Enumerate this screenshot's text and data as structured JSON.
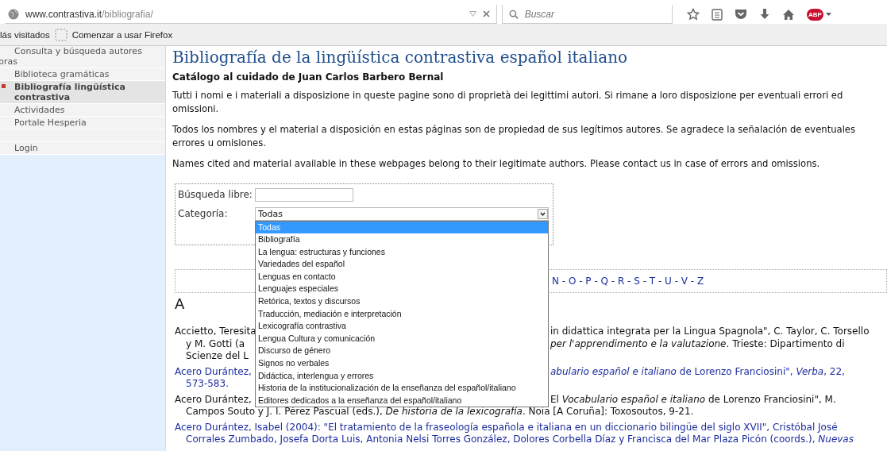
{
  "browser": {
    "url_host": "www.contrastiva.it",
    "url_path": "/bibliografia/",
    "search": {
      "placeholder": "Buscar"
    },
    "abp_label": "ABP",
    "bookmarks": [
      "lás visitados",
      "Comenzar a usar Firefox"
    ]
  },
  "sidebar": {
    "items": [
      {
        "lines": [
          "Consulta y búsqueda autores",
          "bras"
        ],
        "selected": false
      },
      {
        "lines": [
          "Biblioteca gramáticas"
        ],
        "selected": false
      },
      {
        "lines": [
          "Bibliografía lingüística",
          "contrastiva"
        ],
        "selected": true
      },
      {
        "lines": [
          "Actividades"
        ],
        "selected": false
      },
      {
        "lines": [
          "Portale Hesperia"
        ],
        "selected": false
      },
      {
        "selected": false
      },
      {
        "lines": [
          "Login"
        ],
        "selected": false
      }
    ]
  },
  "page": {
    "title": "Bibliografía de la lingüística contrastiva español italiano",
    "subtitle": "Catálogo al cuidado de Juan Carlos Barbero Bernal",
    "paragraphs": [
      "Tutti i nomi e i materiali a disposizione in queste pagine sono di proprietà dei legittimi autori. Si rimane a loro disposizione per eventuali errori ed omissioni.",
      "Todos los nombres y el material a disposición en estas páginas son de propiedad de sus legítimos autores. Se agradece la señalación de eventuales errores u omisiones.",
      "Names cited and material available in these webpages belong to their legitimate authors. Please contact us in case of errors and omissions."
    ]
  },
  "search_form": {
    "free_label": "Búsqueda libre:",
    "category_label": "Categoría:",
    "category_value": "Todas",
    "options": [
      {
        "label": "Todas",
        "selected": true
      },
      {
        "label": "Bibliografía",
        "selected": false
      },
      {
        "label": "La lengua: estructuras y funciones",
        "selected": false
      },
      {
        "label": "Variedades del español",
        "selected": false
      },
      {
        "label": "Lenguas en contacto",
        "selected": false
      },
      {
        "label": "Lenguajes especiales",
        "selected": false
      },
      {
        "label": "Retórica, textos y discursos",
        "selected": false
      },
      {
        "label": "Traducción, mediación e interpretación",
        "selected": false
      },
      {
        "label": "Lexicografía contrastiva",
        "selected": false
      },
      {
        "label": "Lengua Cultura y comunicación",
        "selected": false
      },
      {
        "label": "Discurso de género",
        "selected": false
      },
      {
        "label": "Signos no verbales",
        "selected": false
      },
      {
        "label": "Didáctica, interlengua y errores",
        "selected": false
      },
      {
        "label": "Historia de la institucionalización de la enseñanza del español/italiano",
        "selected": false
      },
      {
        "label": "Editores dedicados a la enseñanza del español/italiano",
        "selected": false
      }
    ]
  },
  "alphabet": "N - O - P - Q - R - S - T - U - V - Z",
  "section_letter": "A",
  "entries": [
    {
      "link": false,
      "lines": [
        {
          "left": "Accietto, Teresita",
          "right": "in didattica integrata per la Lingua Spagnola\", C. Taylor, C. Torsello"
        },
        {
          "left": "y M. Gotti  (a",
          "right": "*per l'apprendimento e la valutazione*. Trieste: Dipartimento di"
        },
        {
          "left": "Scienze del L"
        }
      ]
    },
    {
      "link": true,
      "lines": [
        {
          "left": "Acero Durántez,",
          "right": "*abulario español e italiano* de Lorenzo Franciosini\", *Verba*, 22,"
        },
        {
          "text": "573-583."
        }
      ]
    },
    {
      "link": false,
      "lines": [
        {
          "left": "Acero Durántez,",
          "right": "El *Vocabulario español e italiano* de Lorenzo Franciosini\", M."
        },
        {
          "text": "Campos Souto y J. I. Pérez Pascual (eds.), *De historia de la lexicografía*. Noia [A Coruña]: Toxosoutos, 9-21."
        }
      ]
    },
    {
      "link": true,
      "lines": [
        {
          "text": "Acero Durántez, Isabel (2004): \"El tratamiento de la fraseología española e italiana en un diccionario bilingüe del siglo XVII\", Cristóbal José"
        },
        {
          "text": "Corrales Zumbado, Josefa Dorta Luis, Antonia Nelsi Torres González, Dolores Corbella Díaz y Francisca del Mar Plaza Picón (coords.), *Nuevas*"
        }
      ]
    }
  ]
}
